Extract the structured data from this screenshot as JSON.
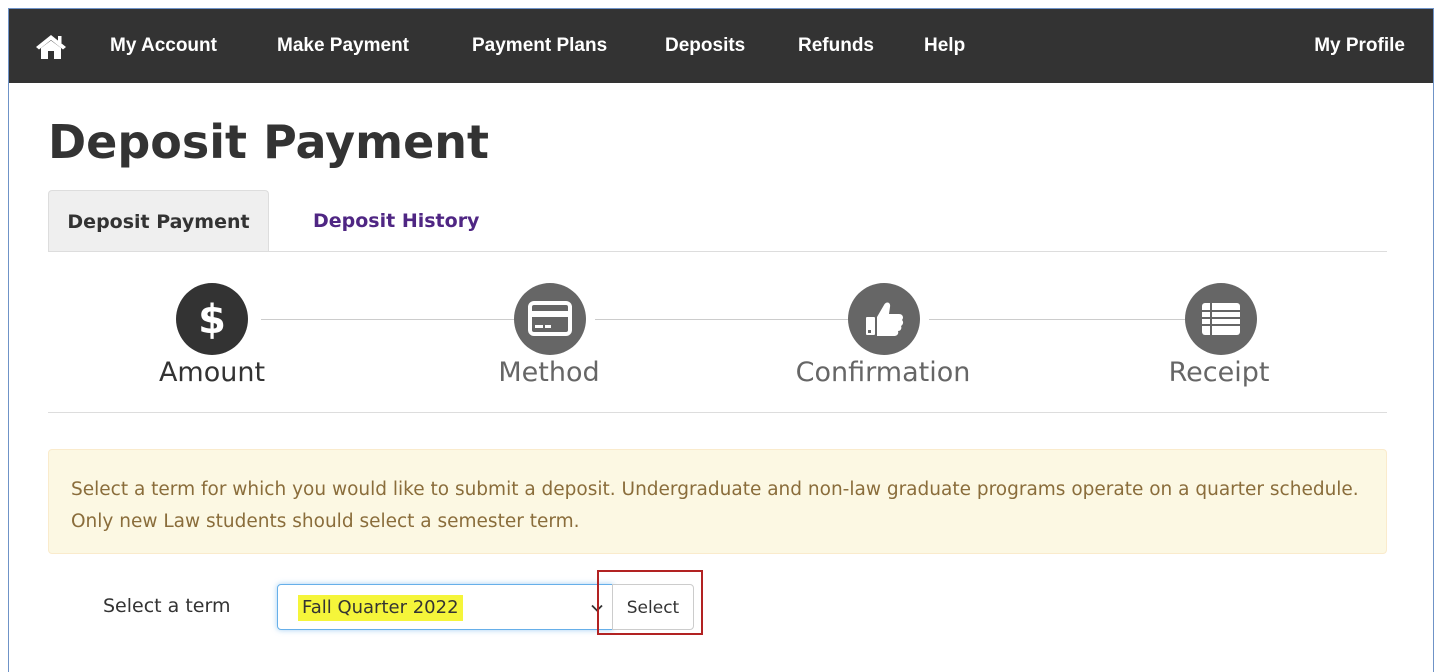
{
  "navbar": {
    "home_icon": "home-icon",
    "items": [
      "My Account",
      "Make Payment",
      "Payment Plans",
      "Deposits",
      "Refunds",
      "Help"
    ],
    "profile": "My Profile"
  },
  "page": {
    "title": "Deposit Payment"
  },
  "tabs": [
    {
      "label": "Deposit Payment",
      "active": true
    },
    {
      "label": "Deposit History",
      "active": false
    }
  ],
  "steps": [
    {
      "label": "Amount",
      "icon": "dollar-icon",
      "active": true
    },
    {
      "label": "Method",
      "icon": "credit-card-icon",
      "active": false
    },
    {
      "label": "Confirmation",
      "icon": "thumbs-up-icon",
      "active": false
    },
    {
      "label": "Receipt",
      "icon": "list-icon",
      "active": false
    }
  ],
  "alert": {
    "text": "Select a term for which you would like to submit a deposit. Undergraduate and non-law graduate programs operate on a quarter schedule. Only new Law students should select a semester term."
  },
  "term_form": {
    "label": "Select a term",
    "selected": "Fall Quarter 2022",
    "button": "Select"
  },
  "colors": {
    "navbar": "#333333",
    "step_active": "#333333",
    "step_inactive": "#666666",
    "tab_link": "#4f2683",
    "alert_bg": "#fcf8e3",
    "alert_text": "#8a6d3b",
    "highlight": "#f5f53a",
    "annotation_box": "#b22222"
  }
}
